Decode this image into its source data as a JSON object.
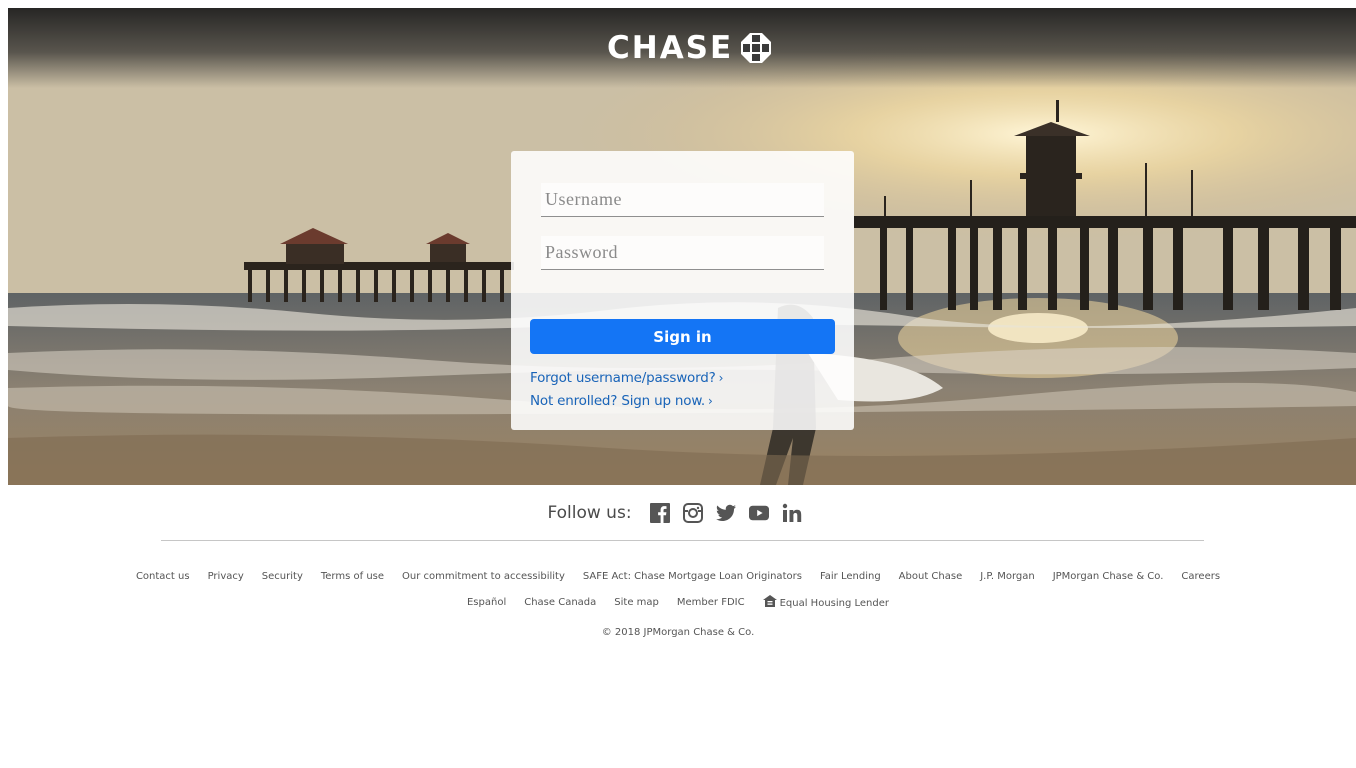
{
  "brand": {
    "name": "CHASE"
  },
  "login": {
    "username_placeholder": "Username",
    "password_placeholder": "Password",
    "signin_label": "Sign in",
    "forgot_label": "Forgot username/password?",
    "enroll_label": "Not enrolled? Sign up now."
  },
  "social": {
    "label": "Follow us:",
    "icons": [
      "facebook-icon",
      "instagram-icon",
      "twitter-icon",
      "youtube-icon",
      "linkedin-icon"
    ]
  },
  "footer": {
    "row1": [
      "Contact us",
      "Privacy",
      "Security",
      "Terms of use",
      "Our commitment to accessibility",
      "SAFE Act: Chase Mortgage Loan Originators",
      "Fair Lending",
      "About Chase",
      "J.P. Morgan",
      "JPMorgan Chase & Co.",
      "Careers"
    ],
    "row2": [
      "Español",
      "Chase Canada",
      "Site map",
      "Member FDIC",
      "Equal Housing Lender"
    ],
    "copyright": "© 2018 JPMorgan Chase & Co."
  },
  "colors": {
    "accent": "#1475f5",
    "link": "#1964b8"
  }
}
